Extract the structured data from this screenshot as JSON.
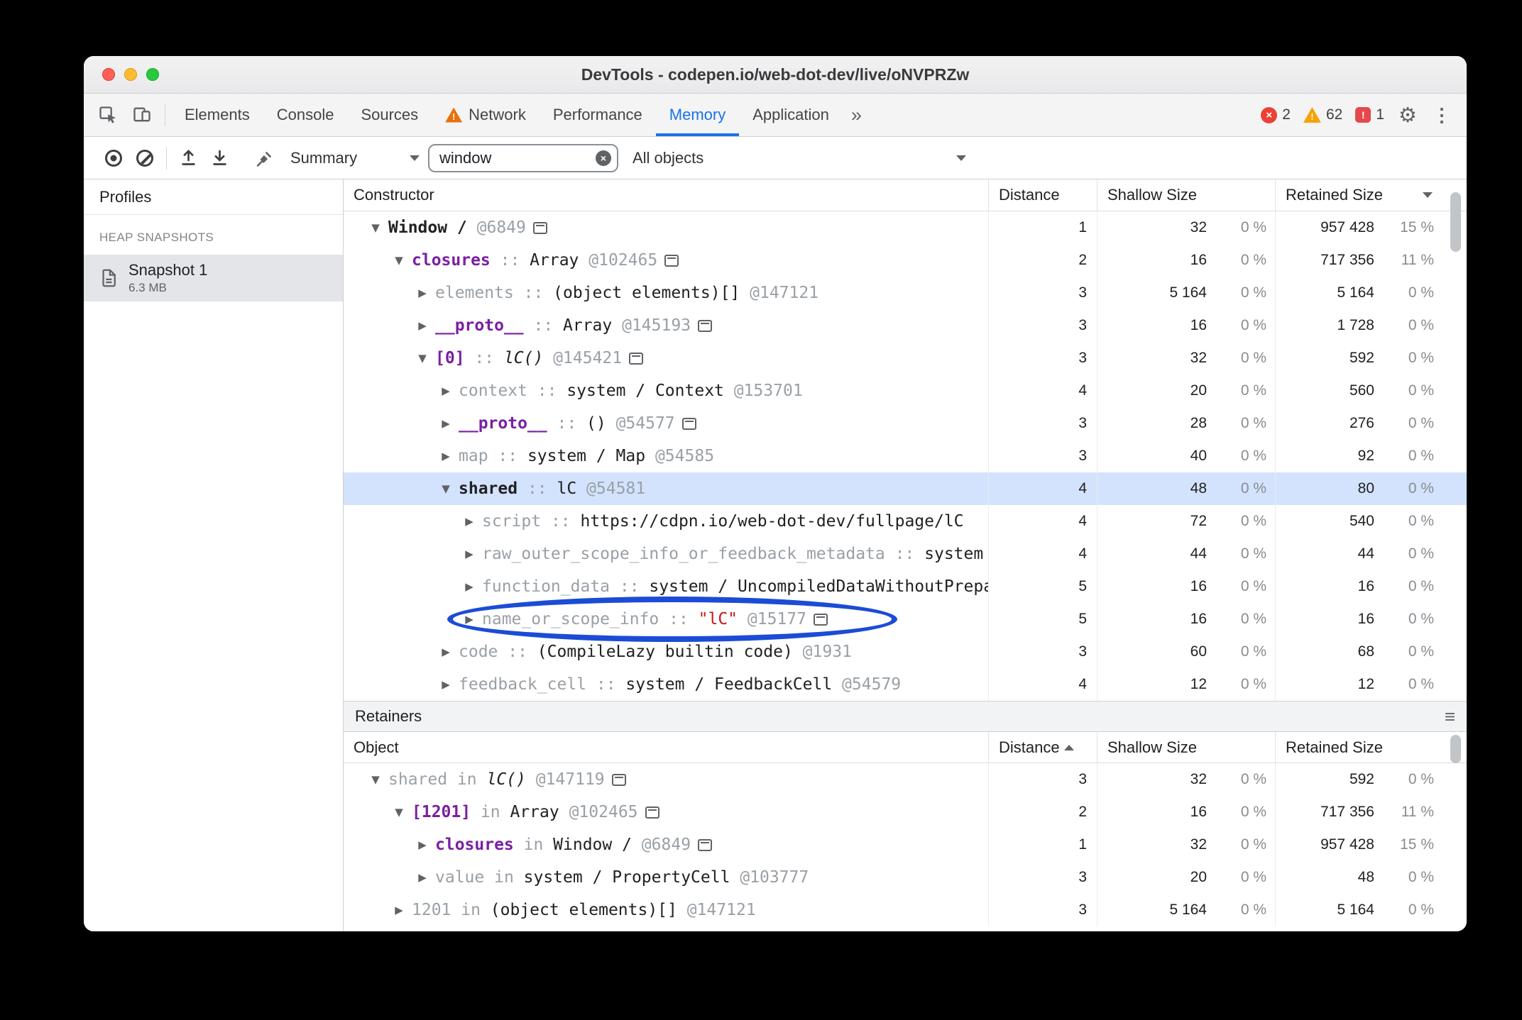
{
  "colors": {
    "accent_blue": "#1a73e8",
    "selection_blue": "#d3e3fd",
    "annotation_blue": "#1b4cd6",
    "property_purple": "#7b1fa2",
    "string_red": "#c41a16",
    "error_red": "#ea4335",
    "warning_orange": "#f9a100",
    "dim_gray": "#9aa0a6"
  },
  "window": {
    "title": "DevTools - codepen.io/web-dot-dev/live/oNVPRZw"
  },
  "icons": {
    "gear": "⚙",
    "more_menu": "⋮",
    "more_tabs": "»",
    "clear_search": "×",
    "error_x": "×",
    "warning_mark": "!",
    "issue_mark": "!",
    "hamburger": "≡"
  },
  "tab_bar": {
    "tabs": [
      {
        "label": "Elements",
        "active": false,
        "warning": false
      },
      {
        "label": "Console",
        "active": false,
        "warning": false
      },
      {
        "label": "Sources",
        "active": false,
        "warning": false
      },
      {
        "label": "Network",
        "active": false,
        "warning": true
      },
      {
        "label": "Performance",
        "active": false,
        "warning": false
      },
      {
        "label": "Memory",
        "active": true,
        "warning": false
      },
      {
        "label": "Application",
        "active": false,
        "warning": false
      }
    ],
    "error_count": "2",
    "warning_count": "62",
    "issue_count": "1"
  },
  "toolbar": {
    "profile_type_label": "Summary",
    "search_value": "window",
    "class_filter_label": "All objects"
  },
  "sidebar": {
    "header": "Profiles",
    "section_label": "HEAP SNAPSHOTS",
    "snapshot_name": "Snapshot 1",
    "snapshot_size": "6.3 MB"
  },
  "constructor_table": {
    "columns": [
      "Constructor",
      "Distance",
      "Shallow Size",
      "Retained Size"
    ],
    "sort": {
      "column": "Retained Size",
      "direction": "desc"
    },
    "rows": [
      {
        "indent": 0,
        "arrow": "open",
        "name": "Window /",
        "nameStyle": "dark",
        "sep": "",
        "value": [],
        "id": "@6849",
        "icon": true,
        "dist": "1",
        "shallow": "32",
        "shallowPct": "0 %",
        "retained": "957 428",
        "retainedPct": "15 %"
      },
      {
        "indent": 1,
        "arrow": "open",
        "name": "closures",
        "nameStyle": "purple",
        "sep": "::",
        "value": [
          {
            "text": "Array",
            "style": "obj"
          }
        ],
        "id": "@102465",
        "icon": true,
        "dist": "2",
        "shallow": "16",
        "shallowPct": "0 %",
        "retained": "717 356",
        "retainedPct": "11 %"
      },
      {
        "indent": 2,
        "arrow": "closed",
        "name": "elements",
        "nameStyle": "gray",
        "sep": "::",
        "value": [
          {
            "text": "(object elements)[]",
            "style": "obj"
          }
        ],
        "id": "@147121",
        "icon": false,
        "dist": "3",
        "shallow": "5 164",
        "shallowPct": "0 %",
        "retained": "5 164",
        "retainedPct": "0 %"
      },
      {
        "indent": 2,
        "arrow": "closed",
        "name": "__proto__",
        "nameStyle": "purple",
        "sep": "::",
        "value": [
          {
            "text": "Array",
            "style": "obj"
          }
        ],
        "id": "@145193",
        "icon": true,
        "dist": "3",
        "shallow": "16",
        "shallowPct": "0 %",
        "retained": "1 728",
        "retainedPct": "0 %"
      },
      {
        "indent": 2,
        "arrow": "open",
        "name": "[0]",
        "nameStyle": "purple",
        "sep": "::",
        "value": [
          {
            "text": "lC()",
            "style": "fn"
          }
        ],
        "id": "@145421",
        "icon": true,
        "dist": "3",
        "shallow": "32",
        "shallowPct": "0 %",
        "retained": "592",
        "retainedPct": "0 %"
      },
      {
        "indent": 3,
        "arrow": "closed",
        "name": "context",
        "nameStyle": "gray",
        "sep": "::",
        "value": [
          {
            "text": "system / Context",
            "style": "obj"
          }
        ],
        "id": "@153701",
        "icon": false,
        "dist": "4",
        "shallow": "20",
        "shallowPct": "0 %",
        "retained": "560",
        "retainedPct": "0 %"
      },
      {
        "indent": 3,
        "arrow": "closed",
        "name": "__proto__",
        "nameStyle": "purple",
        "sep": "::",
        "value": [
          {
            "text": "()",
            "style": "obj"
          }
        ],
        "id": "@54577",
        "icon": true,
        "dist": "3",
        "shallow": "28",
        "shallowPct": "0 %",
        "retained": "276",
        "retainedPct": "0 %"
      },
      {
        "indent": 3,
        "arrow": "closed",
        "name": "map",
        "nameStyle": "gray",
        "sep": "::",
        "value": [
          {
            "text": "system / Map",
            "style": "obj"
          }
        ],
        "id": "@54585",
        "icon": false,
        "dist": "3",
        "shallow": "40",
        "shallowPct": "0 %",
        "retained": "92",
        "retainedPct": "0 %"
      },
      {
        "indent": 3,
        "arrow": "open",
        "name": "shared",
        "nameStyle": "dark",
        "sep": "::",
        "value": [
          {
            "text": "lC",
            "style": "obj"
          }
        ],
        "id": "@54581",
        "icon": false,
        "selected": true,
        "dist": "4",
        "shallow": "48",
        "shallowPct": "0 %",
        "retained": "80",
        "retainedPct": "0 %"
      },
      {
        "indent": 4,
        "arrow": "closed",
        "name": "script",
        "nameStyle": "gray",
        "sep": "::",
        "value": [
          {
            "text": "https://cdpn.io/web-dot-dev/fullpage/lC",
            "style": "obj"
          }
        ],
        "id": "",
        "icon": false,
        "dist": "4",
        "shallow": "72",
        "shallowPct": "0 %",
        "retained": "540",
        "retainedPct": "0 %"
      },
      {
        "indent": 4,
        "arrow": "closed",
        "name": "raw_outer_scope_info_or_feedback_metadata",
        "nameStyle": "gray",
        "sep": "::",
        "value": [
          {
            "text": "system /",
            "style": "obj"
          }
        ],
        "id": "",
        "icon": false,
        "dist": "4",
        "shallow": "44",
        "shallowPct": "0 %",
        "retained": "44",
        "retainedPct": "0 %"
      },
      {
        "indent": 4,
        "arrow": "closed",
        "name": "function_data",
        "nameStyle": "gray",
        "sep": "::",
        "value": [
          {
            "text": "system / UncompiledDataWithoutPreparseData",
            "style": "obj"
          }
        ],
        "id": "",
        "icon": false,
        "dist": "5",
        "shallow": "16",
        "shallowPct": "0 %",
        "retained": "16",
        "retainedPct": "0 %"
      },
      {
        "indent": 4,
        "arrow": "closed",
        "name": "name_or_scope_info",
        "nameStyle": "gray",
        "sep": "::",
        "value": [
          {
            "text": "\"lC\"",
            "style": "str"
          }
        ],
        "id": "@15177",
        "icon": true,
        "annotated": true,
        "dist": "5",
        "shallow": "16",
        "shallowPct": "0 %",
        "retained": "16",
        "retainedPct": "0 %"
      },
      {
        "indent": 3,
        "arrow": "closed",
        "name": "code",
        "nameStyle": "gray",
        "sep": "::",
        "value": [
          {
            "text": "(CompileLazy builtin code)",
            "style": "obj"
          }
        ],
        "id": "@1931",
        "icon": false,
        "dist": "3",
        "shallow": "60",
        "shallowPct": "0 %",
        "retained": "68",
        "retainedPct": "0 %"
      },
      {
        "indent": 3,
        "arrow": "closed",
        "name": "feedback_cell",
        "nameStyle": "gray",
        "sep": "::",
        "value": [
          {
            "text": "system / FeedbackCell",
            "style": "obj"
          }
        ],
        "id": "@54579",
        "icon": false,
        "dist": "4",
        "shallow": "12",
        "shallowPct": "0 %",
        "retained": "12",
        "retainedPct": "0 %"
      }
    ]
  },
  "retainers": {
    "title": "Retainers",
    "columns": [
      "Object",
      "Distance",
      "Shallow Size",
      "Retained Size"
    ],
    "sort": {
      "column": "Distance",
      "direction": "asc"
    },
    "rows": [
      {
        "indent": 0,
        "arrow": "open",
        "name": "shared",
        "nameStyle": "gray",
        "sep": "in",
        "value": [
          {
            "text": "lC()",
            "style": "fn"
          }
        ],
        "id": "@147119",
        "icon": true,
        "dist": "3",
        "shallow": "32",
        "shallowPct": "0 %",
        "retained": "592",
        "retainedPct": "0 %"
      },
      {
        "indent": 1,
        "arrow": "open",
        "name": "[1201]",
        "nameStyle": "purple",
        "sep": "in",
        "value": [
          {
            "text": "Array",
            "style": "obj"
          }
        ],
        "id": "@102465",
        "icon": true,
        "dist": "2",
        "shallow": "16",
        "shallowPct": "0 %",
        "retained": "717 356",
        "retainedPct": "11 %"
      },
      {
        "indent": 2,
        "arrow": "closed",
        "name": "closures",
        "nameStyle": "purple",
        "sep": "in",
        "value": [
          {
            "text": "Window /",
            "style": "obj"
          }
        ],
        "id": "@6849",
        "icon": true,
        "dist": "1",
        "shallow": "32",
        "shallowPct": "0 %",
        "retained": "957 428",
        "retainedPct": "15 %"
      },
      {
        "indent": 2,
        "arrow": "closed",
        "name": "value",
        "nameStyle": "gray",
        "sep": "in",
        "value": [
          {
            "text": "system / PropertyCell",
            "style": "obj"
          }
        ],
        "id": "@103777",
        "icon": false,
        "dist": "3",
        "shallow": "20",
        "shallowPct": "0 %",
        "retained": "48",
        "retainedPct": "0 %"
      },
      {
        "indent": 1,
        "arrow": "closed",
        "name": "1201",
        "nameStyle": "gray",
        "sep": "in",
        "value": [
          {
            "text": "(object elements)[]",
            "style": "obj"
          }
        ],
        "id": "@147121",
        "icon": false,
        "dist": "3",
        "shallow": "5 164",
        "shallowPct": "0 %",
        "retained": "5 164",
        "retainedPct": "0 %"
      }
    ]
  }
}
